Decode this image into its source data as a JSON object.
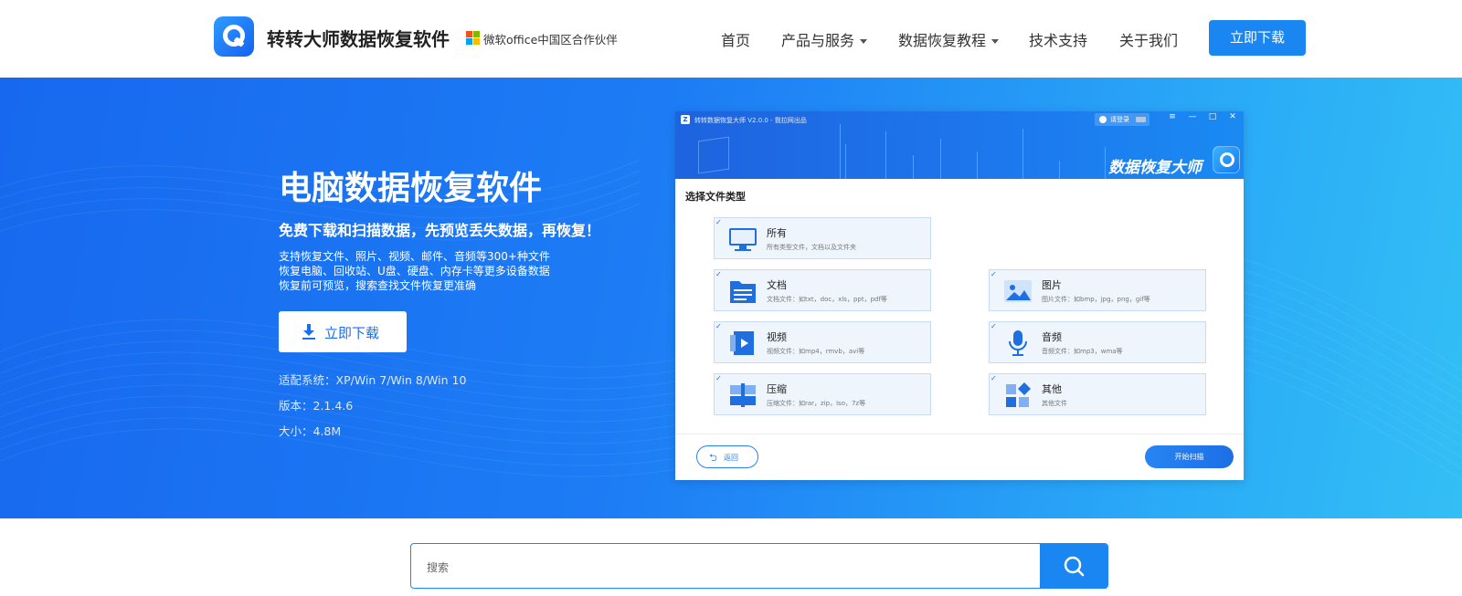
{
  "header": {
    "brand": "转转大师数据恢复软件",
    "partner": "微软office中国区合作伙伴",
    "nav": [
      {
        "label": "首页",
        "dropdown": false
      },
      {
        "label": "产品与服务",
        "dropdown": true
      },
      {
        "label": "数据恢复教程",
        "dropdown": true
      },
      {
        "label": "技术支持",
        "dropdown": false
      },
      {
        "label": "关于我们",
        "dropdown": false
      }
    ],
    "download_label": "立即下载"
  },
  "hero": {
    "title": "电脑数据恢复软件",
    "subtitle": "免费下载和扫描数据，先预览丢失数据，再恢复！",
    "features": [
      "支持恢复文件、照片、视频、邮件、音频等300+种文件",
      "恢复电脑、回收站、U盘、硬盘、内存卡等更多设备数据",
      "恢复前可预览，搜索查找文件恢复更准确"
    ],
    "download_label": "立即下载",
    "meta": [
      "适配系统：XP/Win 7/Win 8/Win 10",
      "版本：2.1.4.6",
      "大小：4.8M"
    ]
  },
  "app_window": {
    "title": "转转数据恢复大师 V2.0.0 - 我拉网出品",
    "login": "请登录",
    "brand": "数据恢复大师",
    "section_title": "选择文件类型",
    "cards": [
      {
        "name": "所有",
        "desc": "所有类型文件，文档以及文件夹",
        "icon": "monitor-icon"
      },
      {
        "name": "文档",
        "desc": "文档文件：如txt，doc，xls，ppt，pdf等",
        "icon": "document-icon"
      },
      {
        "name": "图片",
        "desc": "图片文件：如bmp，jpg，png，gif等",
        "icon": "image-icon"
      },
      {
        "name": "视频",
        "desc": "视频文件：如mp4，rmvb，avi等",
        "icon": "video-icon"
      },
      {
        "name": "音频",
        "desc": "音频文件：如mp3，wma等",
        "icon": "microphone-icon"
      },
      {
        "name": "压缩",
        "desc": "压缩文件：如rar，zip，iso，7z等",
        "icon": "archive-icon"
      },
      {
        "name": "其他",
        "desc": "其他文件",
        "icon": "other-icon"
      }
    ],
    "back_label": "返回",
    "scan_label": "开始扫描"
  },
  "search": {
    "placeholder": "搜索"
  },
  "colors": {
    "accent": "#1a86f2",
    "hero_start": "#1768ee",
    "hero_end": "#33bff5"
  }
}
